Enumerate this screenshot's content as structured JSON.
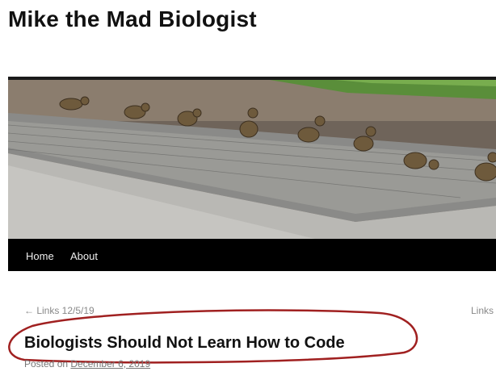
{
  "site": {
    "title": "Mike the Mad Biologist"
  },
  "nav": {
    "items": [
      {
        "label": "Home"
      },
      {
        "label": "About"
      }
    ]
  },
  "post_nav": {
    "previous": "← Links 12/5/19",
    "next": "Links"
  },
  "post": {
    "title": "Biologists Should Not Learn How to Code",
    "posted_prefix": "Posted on",
    "date": "December 6, 2019"
  },
  "colors": {
    "nav_background": "#000000",
    "annotation_circle": "#a02020",
    "meta_text": "#777777"
  }
}
